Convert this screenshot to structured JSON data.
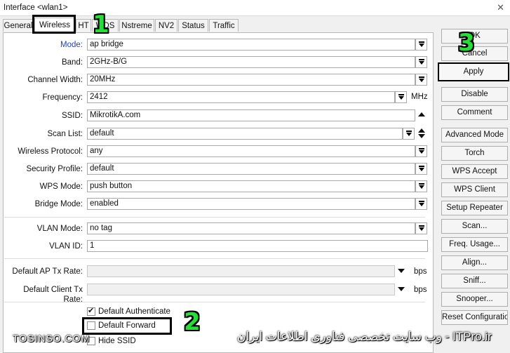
{
  "window": {
    "title": "Interface <wlan1>",
    "close_glyph": "✕"
  },
  "tabs": [
    {
      "label": "General"
    },
    {
      "label": "Wireless"
    },
    {
      "label": "HT"
    },
    {
      "label": "WDS"
    },
    {
      "label": "Nstreme"
    },
    {
      "label": "NV2"
    },
    {
      "label": "Status"
    },
    {
      "label": "Traffic"
    }
  ],
  "fields": {
    "mode": {
      "label": "Mode:",
      "value": "ap bridge"
    },
    "band": {
      "label": "Band:",
      "value": "2GHz-B/G"
    },
    "channel_width": {
      "label": "Channel Width:",
      "value": "20MHz"
    },
    "frequency": {
      "label": "Frequency:",
      "value": "2412",
      "unit": "MHz"
    },
    "ssid": {
      "label": "SSID:",
      "value": "MikrotikA.com"
    },
    "scan_list": {
      "label": "Scan List:",
      "value": "default"
    },
    "wireless_protocol": {
      "label": "Wireless Protocol:",
      "value": "any"
    },
    "security_profile": {
      "label": "Security Profile:",
      "value": "default"
    },
    "wps_mode": {
      "label": "WPS Mode:",
      "value": "push button"
    },
    "bridge_mode": {
      "label": "Bridge Mode:",
      "value": "enabled"
    },
    "vlan_mode": {
      "label": "VLAN Mode:",
      "value": "no tag"
    },
    "vlan_id": {
      "label": "VLAN ID:",
      "value": "1"
    },
    "default_ap_tx_rate": {
      "label": "Default AP Tx Rate:",
      "value": "",
      "unit": "bps"
    },
    "default_client_tx_rate": {
      "label": "Default Client Tx Rate:",
      "value": "",
      "unit": "bps"
    }
  },
  "checkboxes": {
    "default_authenticate": {
      "label": "Default Authenticate",
      "checked": true
    },
    "default_forward": {
      "label": "Default Forward",
      "checked": false
    },
    "hide_ssid": {
      "label": "Hide SSID",
      "checked": false
    }
  },
  "buttons": {
    "ok": "OK",
    "cancel": "Cancel",
    "apply": "Apply",
    "disable": "Disable",
    "comment": "Comment",
    "advanced_mode": "Advanced Mode",
    "torch": "Torch",
    "wps_accept": "WPS Accept",
    "wps_client": "WPS Client",
    "setup_repeater": "Setup Repeater",
    "scan": "Scan...",
    "freq_usage": "Freq. Usage...",
    "align": "Align...",
    "sniff": "Sniff...",
    "snooper": "Snooper...",
    "reset_configuration": "Reset Configuration"
  },
  "annotations": {
    "step1": "1",
    "step2": "2",
    "step3": "3"
  },
  "watermark": {
    "left": "TOSINSO.COM",
    "right": "ITPro.ir - وب سایت تخصصی فناوری اطلاعات ایران"
  },
  "colors": {
    "label_blue": "#1f3fbf",
    "annotation_green": "#22e034"
  }
}
